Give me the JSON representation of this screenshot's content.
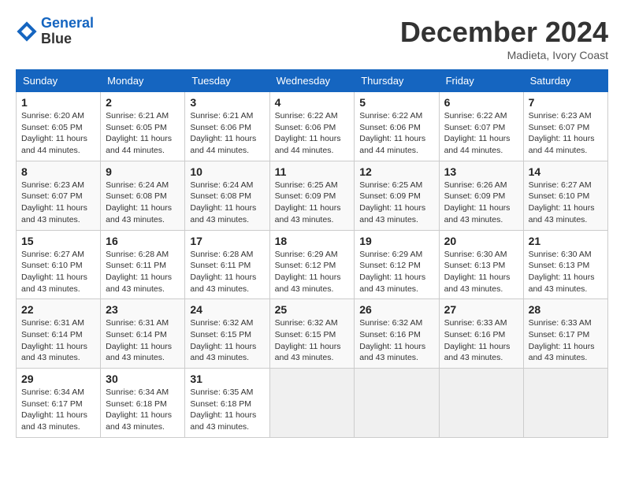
{
  "header": {
    "logo_line1": "General",
    "logo_line2": "Blue",
    "month_title": "December 2024",
    "location": "Madieta, Ivory Coast"
  },
  "days_of_week": [
    "Sunday",
    "Monday",
    "Tuesday",
    "Wednesday",
    "Thursday",
    "Friday",
    "Saturday"
  ],
  "weeks": [
    [
      {
        "day": "1",
        "sunrise": "6:20 AM",
        "sunset": "6:05 PM",
        "daylight": "11 hours and 44 minutes."
      },
      {
        "day": "2",
        "sunrise": "6:21 AM",
        "sunset": "6:05 PM",
        "daylight": "11 hours and 44 minutes."
      },
      {
        "day": "3",
        "sunrise": "6:21 AM",
        "sunset": "6:06 PM",
        "daylight": "11 hours and 44 minutes."
      },
      {
        "day": "4",
        "sunrise": "6:22 AM",
        "sunset": "6:06 PM",
        "daylight": "11 hours and 44 minutes."
      },
      {
        "day": "5",
        "sunrise": "6:22 AM",
        "sunset": "6:06 PM",
        "daylight": "11 hours and 44 minutes."
      },
      {
        "day": "6",
        "sunrise": "6:22 AM",
        "sunset": "6:07 PM",
        "daylight": "11 hours and 44 minutes."
      },
      {
        "day": "7",
        "sunrise": "6:23 AM",
        "sunset": "6:07 PM",
        "daylight": "11 hours and 44 minutes."
      }
    ],
    [
      {
        "day": "8",
        "sunrise": "6:23 AM",
        "sunset": "6:07 PM",
        "daylight": "11 hours and 43 minutes."
      },
      {
        "day": "9",
        "sunrise": "6:24 AM",
        "sunset": "6:08 PM",
        "daylight": "11 hours and 43 minutes."
      },
      {
        "day": "10",
        "sunrise": "6:24 AM",
        "sunset": "6:08 PM",
        "daylight": "11 hours and 43 minutes."
      },
      {
        "day": "11",
        "sunrise": "6:25 AM",
        "sunset": "6:09 PM",
        "daylight": "11 hours and 43 minutes."
      },
      {
        "day": "12",
        "sunrise": "6:25 AM",
        "sunset": "6:09 PM",
        "daylight": "11 hours and 43 minutes."
      },
      {
        "day": "13",
        "sunrise": "6:26 AM",
        "sunset": "6:09 PM",
        "daylight": "11 hours and 43 minutes."
      },
      {
        "day": "14",
        "sunrise": "6:27 AM",
        "sunset": "6:10 PM",
        "daylight": "11 hours and 43 minutes."
      }
    ],
    [
      {
        "day": "15",
        "sunrise": "6:27 AM",
        "sunset": "6:10 PM",
        "daylight": "11 hours and 43 minutes."
      },
      {
        "day": "16",
        "sunrise": "6:28 AM",
        "sunset": "6:11 PM",
        "daylight": "11 hours and 43 minutes."
      },
      {
        "day": "17",
        "sunrise": "6:28 AM",
        "sunset": "6:11 PM",
        "daylight": "11 hours and 43 minutes."
      },
      {
        "day": "18",
        "sunrise": "6:29 AM",
        "sunset": "6:12 PM",
        "daylight": "11 hours and 43 minutes."
      },
      {
        "day": "19",
        "sunrise": "6:29 AM",
        "sunset": "6:12 PM",
        "daylight": "11 hours and 43 minutes."
      },
      {
        "day": "20",
        "sunrise": "6:30 AM",
        "sunset": "6:13 PM",
        "daylight": "11 hours and 43 minutes."
      },
      {
        "day": "21",
        "sunrise": "6:30 AM",
        "sunset": "6:13 PM",
        "daylight": "11 hours and 43 minutes."
      }
    ],
    [
      {
        "day": "22",
        "sunrise": "6:31 AM",
        "sunset": "6:14 PM",
        "daylight": "11 hours and 43 minutes."
      },
      {
        "day": "23",
        "sunrise": "6:31 AM",
        "sunset": "6:14 PM",
        "daylight": "11 hours and 43 minutes."
      },
      {
        "day": "24",
        "sunrise": "6:32 AM",
        "sunset": "6:15 PM",
        "daylight": "11 hours and 43 minutes."
      },
      {
        "day": "25",
        "sunrise": "6:32 AM",
        "sunset": "6:15 PM",
        "daylight": "11 hours and 43 minutes."
      },
      {
        "day": "26",
        "sunrise": "6:32 AM",
        "sunset": "6:16 PM",
        "daylight": "11 hours and 43 minutes."
      },
      {
        "day": "27",
        "sunrise": "6:33 AM",
        "sunset": "6:16 PM",
        "daylight": "11 hours and 43 minutes."
      },
      {
        "day": "28",
        "sunrise": "6:33 AM",
        "sunset": "6:17 PM",
        "daylight": "11 hours and 43 minutes."
      }
    ],
    [
      {
        "day": "29",
        "sunrise": "6:34 AM",
        "sunset": "6:17 PM",
        "daylight": "11 hours and 43 minutes."
      },
      {
        "day": "30",
        "sunrise": "6:34 AM",
        "sunset": "6:18 PM",
        "daylight": "11 hours and 43 minutes."
      },
      {
        "day": "31",
        "sunrise": "6:35 AM",
        "sunset": "6:18 PM",
        "daylight": "11 hours and 43 minutes."
      },
      null,
      null,
      null,
      null
    ]
  ]
}
